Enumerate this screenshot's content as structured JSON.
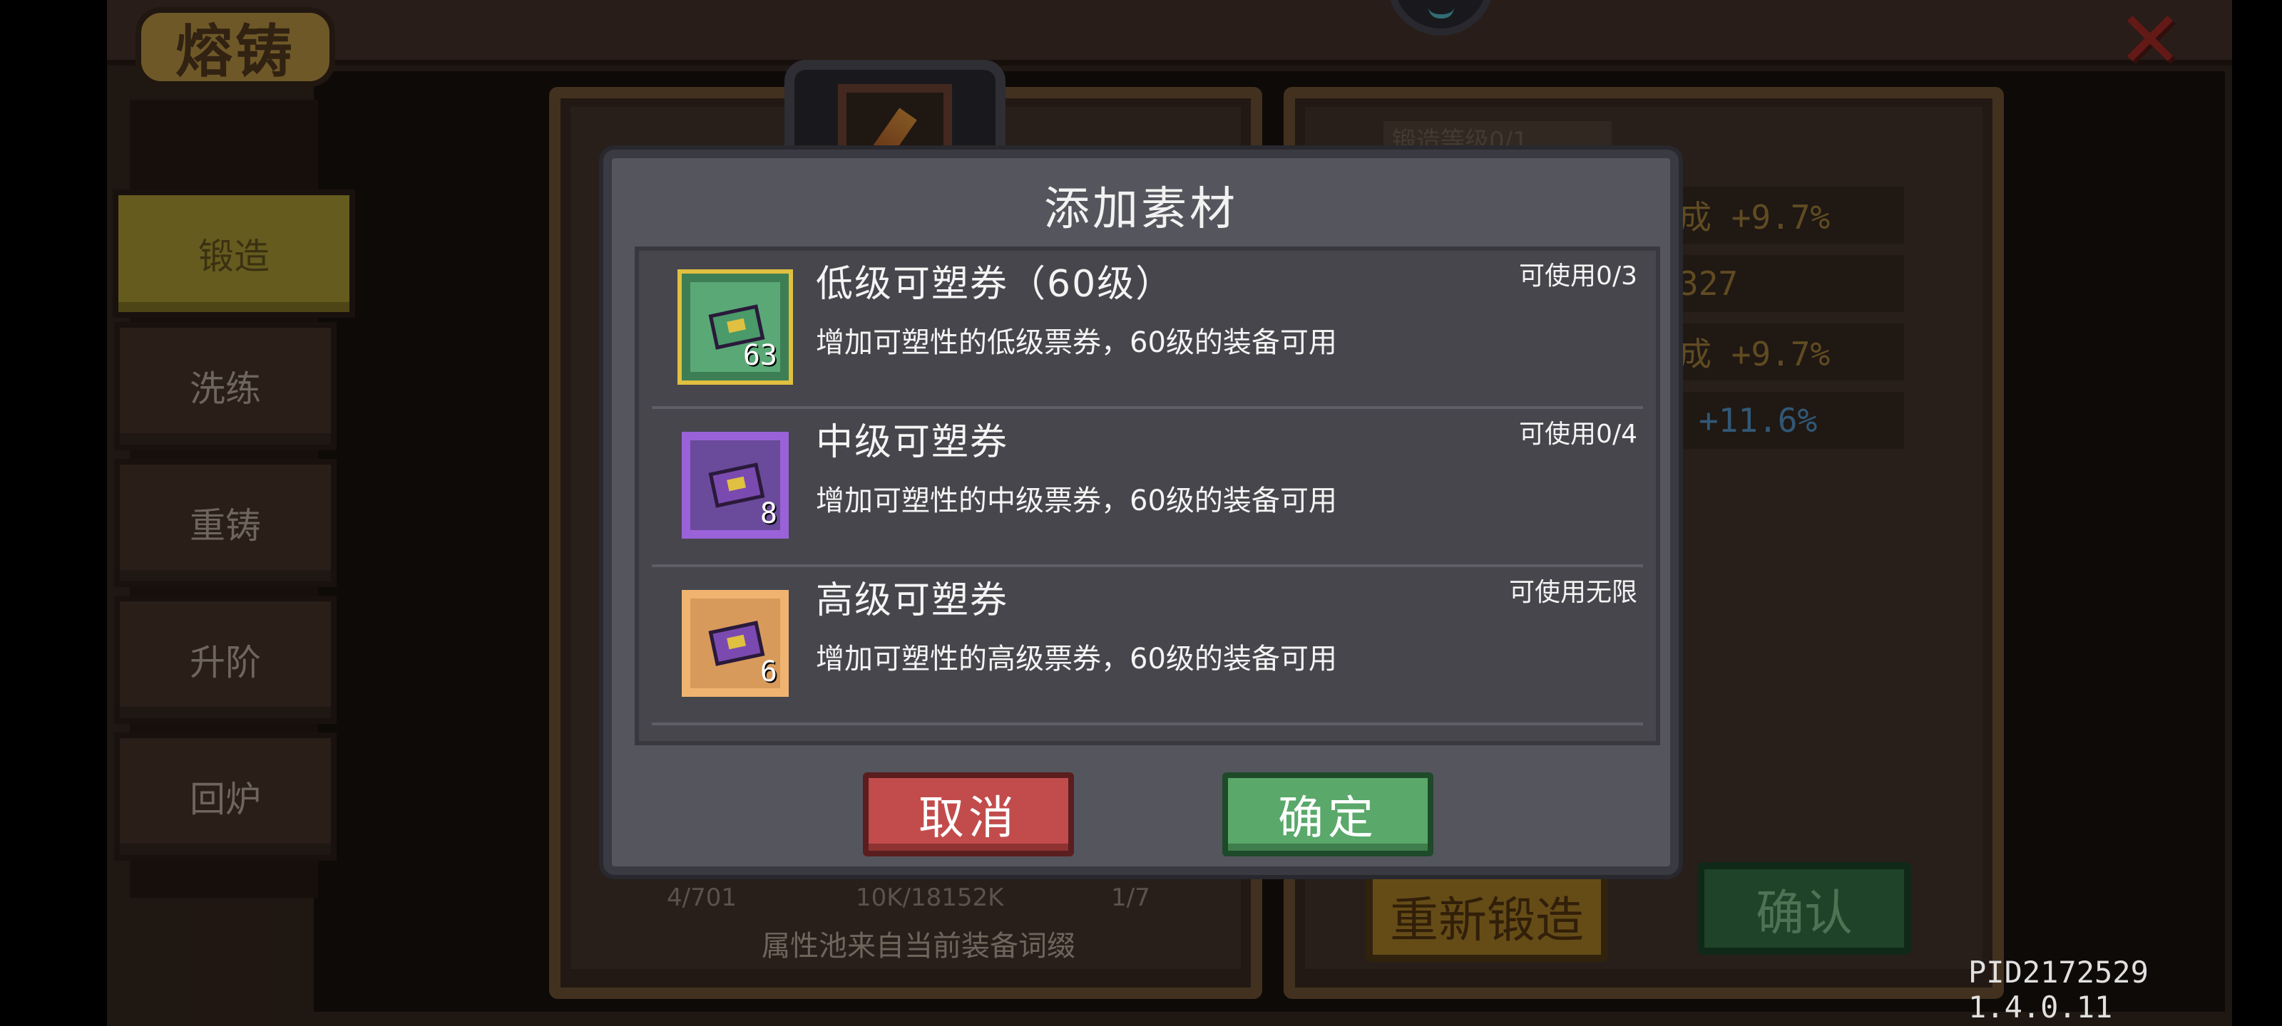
{
  "window": {
    "title": "熔铸",
    "close_symbol": "✕"
  },
  "side_tabs": [
    {
      "label": "锻造",
      "active": true
    },
    {
      "label": "洗练",
      "active": false
    },
    {
      "label": "重铸",
      "active": false
    },
    {
      "label": "升阶",
      "active": false
    },
    {
      "label": "回炉",
      "active": false
    }
  ],
  "left_panel": {
    "stats": [
      "4/701",
      "10K/18152K",
      "1/7"
    ],
    "footer": "属性池来自当前装备词缀"
  },
  "right_panel": {
    "heading": "锻造等级0/1",
    "stat_rows": [
      "成 +9.7%",
      "327",
      "成 +9.7%",
      "+11.6%"
    ],
    "reforge_label": "重新锻造",
    "confirm_label": "确认"
  },
  "modal": {
    "title": "添加素材",
    "items": [
      {
        "name": "低级可塑券（60级）",
        "usage": "可使用0/3",
        "desc": "增加可塑性的低级票券，60级的装备可用",
        "count": "63",
        "tier": "green",
        "icon": "ticket-icon"
      },
      {
        "name": "中级可塑券",
        "usage": "可使用0/4",
        "desc": "增加可塑性的中级票券，60级的装备可用",
        "count": "8",
        "tier": "purple",
        "icon": "ticket-icon"
      },
      {
        "name": "高级可塑券",
        "usage": "可使用无限",
        "desc": "增加可塑性的高级票券，60级的装备可用",
        "count": "6",
        "tier": "orange",
        "icon": "ticket-icon"
      }
    ],
    "cancel_label": "取消",
    "ok_label": "确定"
  },
  "footer": {
    "pid": "PID2172529 1.4.0.11"
  },
  "colors": {
    "active_tab": "#b9a63a",
    "cancel": "#c24c4c",
    "confirm": "#5aa86a",
    "modal_bg": "#55555d"
  }
}
